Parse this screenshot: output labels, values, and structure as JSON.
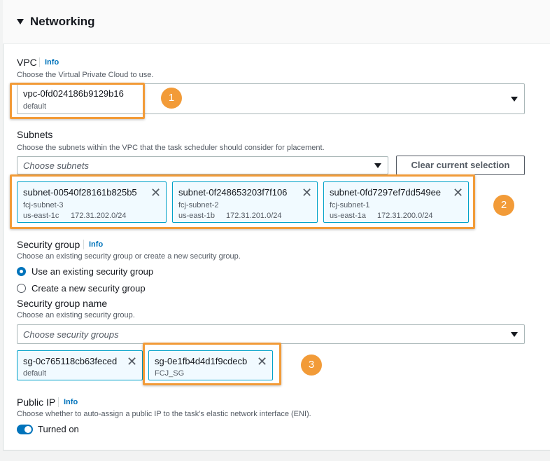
{
  "section": {
    "title": "Networking"
  },
  "vpc": {
    "label": "VPC",
    "info": "Info",
    "description": "Choose the Virtual Private Cloud to use.",
    "selected_id": "vpc-0fd024186b9129b16",
    "selected_sub": "default"
  },
  "subnets": {
    "label": "Subnets",
    "description": "Choose the subnets within the VPC that the task scheduler should consider for placement.",
    "placeholder": "Choose subnets",
    "clear_label": "Clear current selection",
    "tokens": [
      {
        "id": "subnet-00540f28161b825b5",
        "name": "fcj-subnet-3",
        "az": "us-east-1c",
        "cidr": "172.31.202.0/24"
      },
      {
        "id": "subnet-0f248653203f7f106",
        "name": "fcj-subnet-2",
        "az": "us-east-1b",
        "cidr": "172.31.201.0/24"
      },
      {
        "id": "subnet-0fd7297ef7dd549ee",
        "name": "fcj-subnet-1",
        "az": "us-east-1a",
        "cidr": "172.31.200.0/24"
      }
    ]
  },
  "security_group": {
    "label": "Security group",
    "info": "Info",
    "description": "Choose an existing security group or create a new security group.",
    "options": [
      "Use an existing security group",
      "Create a new security group"
    ],
    "selected_option": "Use an existing security group",
    "name_label": "Security group name",
    "name_description": "Choose an existing security group.",
    "placeholder": "Choose security groups",
    "tokens": [
      {
        "id": "sg-0c765118cb63feced",
        "name": "default"
      },
      {
        "id": "sg-0e1fb4d4d1f9cdecb",
        "name": "FCJ_SG"
      }
    ]
  },
  "public_ip": {
    "label": "Public IP",
    "info": "Info",
    "description": "Choose whether to auto-assign a public IP to the task's elastic network interface (ENI).",
    "state": "Turned on",
    "enabled": true
  },
  "annotations": [
    "1",
    "2",
    "3"
  ],
  "colors": {
    "accent": "#0073bb",
    "highlight": "#f29b38",
    "token_bg": "#f1faff",
    "token_border": "#00a1c9"
  }
}
